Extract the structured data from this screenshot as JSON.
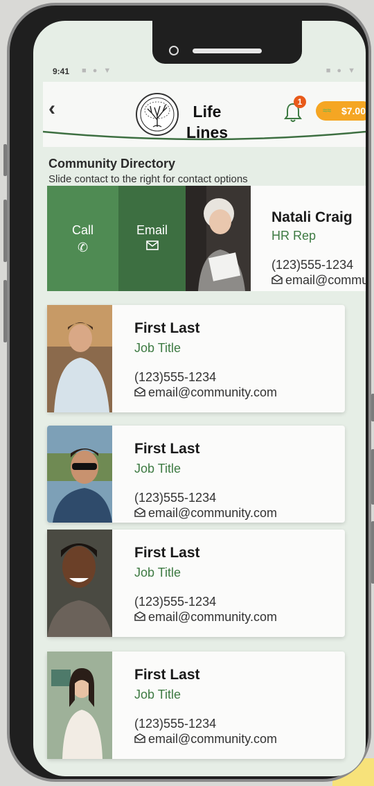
{
  "status_bar": {
    "time": "9:41",
    "left_icons": "■ ● ▼",
    "right_icons": "■ ● ▼"
  },
  "header": {
    "back_icon": "chevron-left-icon",
    "app_name": "Life Lines",
    "notification_count": "1",
    "balance": "$7.00",
    "balance_icon_glyph": "≈≈"
  },
  "directory": {
    "title": "Community Directory",
    "subtitle": "Slide contact to the right for contact options"
  },
  "swipe_card": {
    "call_label": "Call",
    "email_label": "Email",
    "name": "Natali Craig",
    "job_title": "HR Rep",
    "phone": "(123)555-1234",
    "email": "email@community.com"
  },
  "contacts": [
    {
      "name": "First Last",
      "job_title": "Job Title",
      "phone": "(123)555-1234",
      "email": "email@community.com"
    },
    {
      "name": "First Last",
      "job_title": "Job Title",
      "phone": "(123)555-1234",
      "email": "email@community.com"
    },
    {
      "name": "First Last",
      "job_title": "Job Title",
      "phone": "(123)555-1234",
      "email": "email@community.com"
    },
    {
      "name": "First Last",
      "job_title": "Job Title",
      "phone": "(123)555-1234",
      "email": "email@community.com"
    }
  ],
  "colors": {
    "accent_green": "#3d7a42",
    "call_green": "#4f8b53",
    "email_green": "#3d6f41",
    "balance_orange": "#f5a623",
    "badge_orange": "#e85a1a"
  }
}
